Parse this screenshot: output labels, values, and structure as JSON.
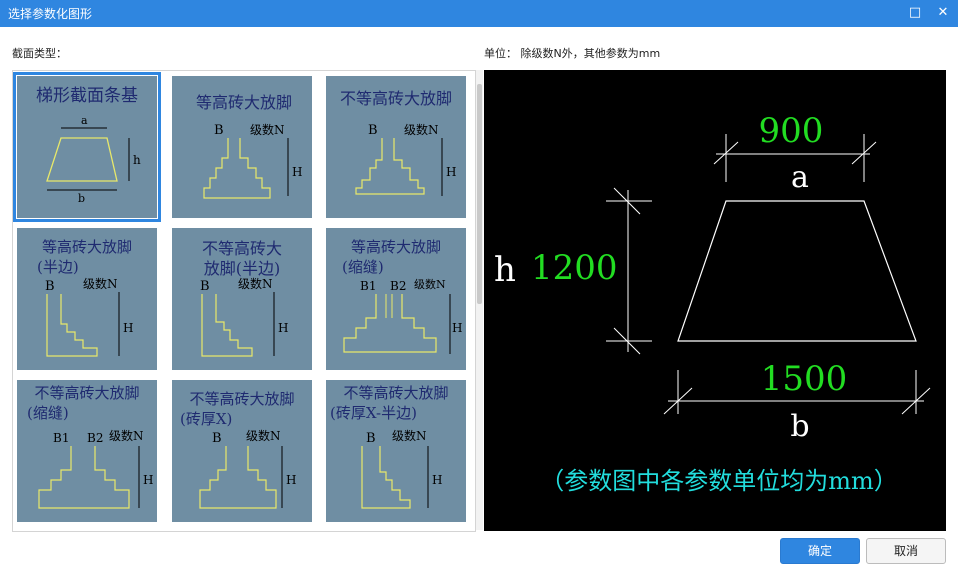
{
  "window": {
    "title": "选择参数化图形"
  },
  "labels": {
    "section_type": "截面类型：",
    "unit_note": "单位：  除级数N外，其他参数为mm"
  },
  "shapes": [
    {
      "line1": "梯形截面条基",
      "line2": "",
      "selected": true
    },
    {
      "line1": "等高砖大放脚",
      "line2": "",
      "selected": false
    },
    {
      "line1": "不等高砖大放脚",
      "line2": "",
      "selected": false
    },
    {
      "line1": "等高砖大放脚",
      "line2": "(半边)",
      "selected": false
    },
    {
      "line1": "不等高砖大",
      "line2": "放脚(半边)",
      "selected": false
    },
    {
      "line1": "等高砖大放脚",
      "line2": "(缩缝)",
      "selected": false
    },
    {
      "line1": "不等高砖大放脚",
      "line2": "(缩缝)",
      "selected": false
    },
    {
      "line1": "不等高砖大放脚",
      "line2": "(砖厚X)",
      "selected": false
    },
    {
      "line1": "不等高砖大放脚",
      "line2": "(砖厚X-半边)",
      "selected": false
    }
  ],
  "preview": {
    "top_value": "900",
    "top_label": "a",
    "height_label": "h",
    "height_value": "1200",
    "bottom_value": "1500",
    "bottom_label": "b",
    "note": "（参数图中各参数单位均为mm）"
  },
  "buttons": {
    "ok": "确定",
    "cancel": "取消"
  },
  "colors": {
    "accent": "#2f86e0",
    "value_green": "#22dd22",
    "note_cyan": "#22dddd",
    "thumb_bg": "#6f8ea3",
    "thumb_line": "#e8e86a"
  }
}
